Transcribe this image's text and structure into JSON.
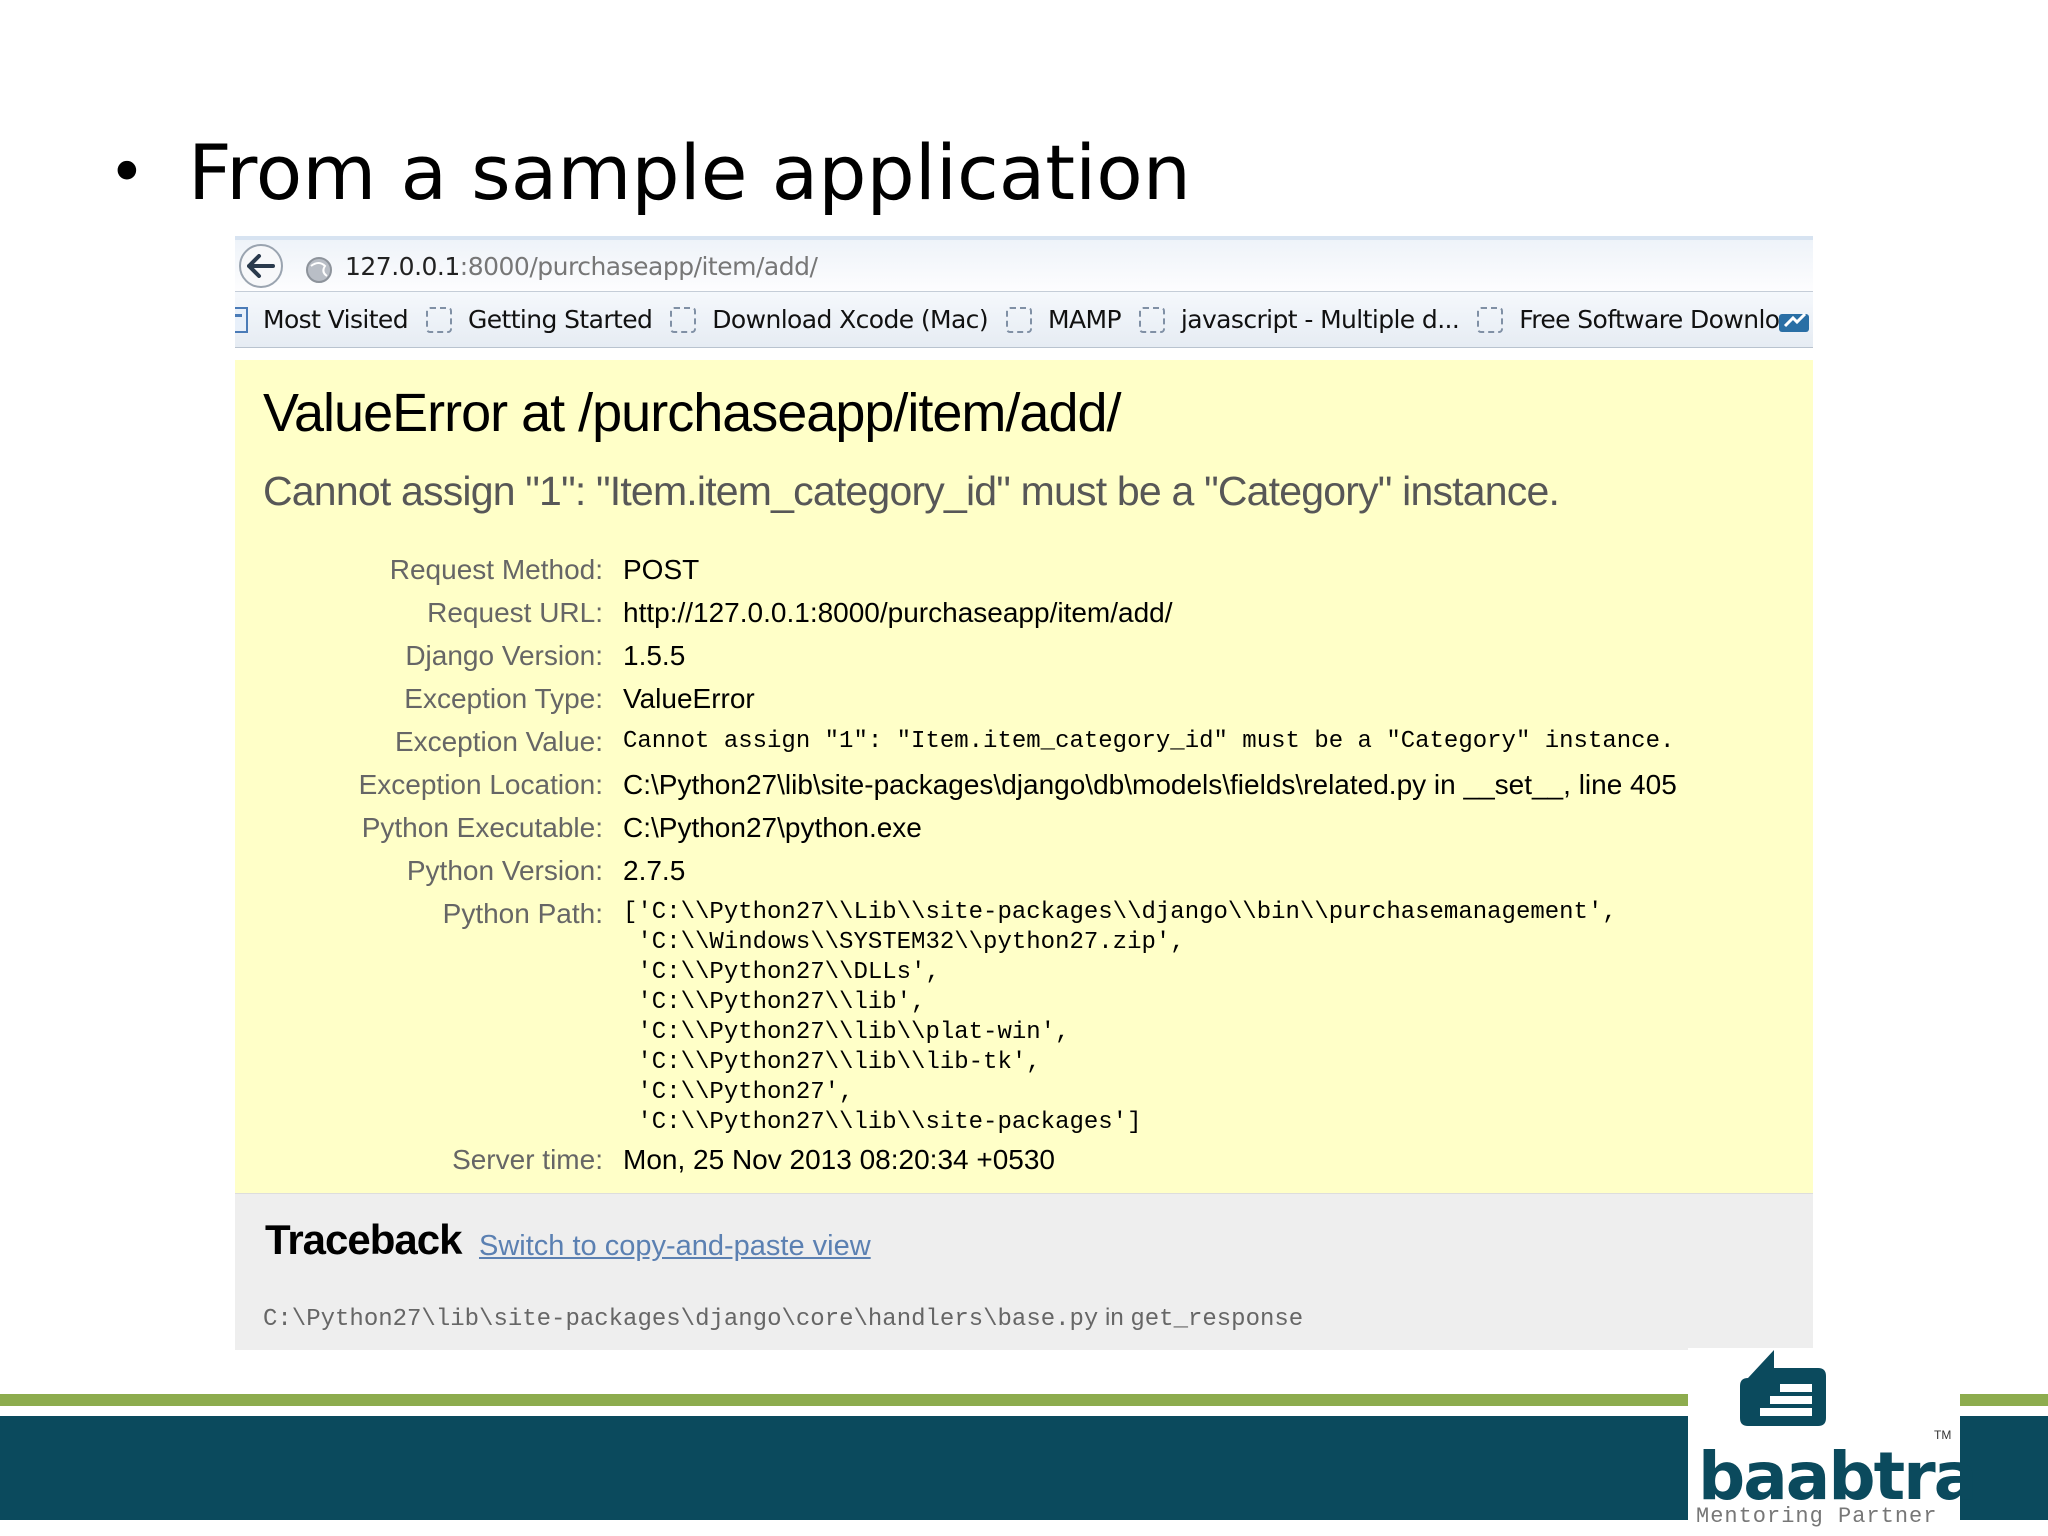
{
  "slide": {
    "bullet": "•",
    "title": "From a sample application"
  },
  "browser": {
    "url_host": "127.0.0.1",
    "url_rest": ":8000/purchaseapp/item/add/",
    "bookmarks": [
      {
        "label": "Most Visited",
        "icon": "page-icon"
      },
      {
        "label": "Getting Started",
        "icon": "bookmark-folder-icon"
      },
      {
        "label": "Download Xcode (Mac)",
        "icon": "bookmark-folder-icon"
      },
      {
        "label": "MAMP",
        "icon": "bookmark-folder-icon"
      },
      {
        "label": "javascript - Multiple d...",
        "icon": "bookmark-folder-icon"
      },
      {
        "label": "Free Software Downlo...",
        "icon": "bookmark-folder-icon"
      }
    ]
  },
  "error": {
    "title": "ValueError at /purchaseapp/item/add/",
    "subtitle": "Cannot assign \"1\": \"Item.item_category_id\" must be a \"Category\" instance.",
    "meta": {
      "request_method_label": "Request Method:",
      "request_method": "POST",
      "request_url_label": "Request URL:",
      "request_url": "http://127.0.0.1:8000/purchaseapp/item/add/",
      "django_version_label": "Django Version:",
      "django_version": "1.5.5",
      "exception_type_label": "Exception Type:",
      "exception_type": "ValueError",
      "exception_value_label": "Exception Value:",
      "exception_value": "Cannot assign \"1\": \"Item.item_category_id\" must be a \"Category\" instance.",
      "exception_location_label": "Exception Location:",
      "exception_location": "C:\\Python27\\lib\\site-packages\\django\\db\\models\\fields\\related.py in __set__, line 405",
      "python_executable_label": "Python Executable:",
      "python_executable": "C:\\Python27\\python.exe",
      "python_version_label": "Python Version:",
      "python_version": "2.7.5",
      "python_path_label": "Python Path:",
      "python_path": "['C:\\\\Python27\\\\Lib\\\\site-packages\\\\django\\\\bin\\\\purchasemanagement',\n 'C:\\\\Windows\\\\SYSTEM32\\\\python27.zip',\n 'C:\\\\Python27\\\\DLLs',\n 'C:\\\\Python27\\\\lib',\n 'C:\\\\Python27\\\\lib\\\\plat-win',\n 'C:\\\\Python27\\\\lib\\\\lib-tk',\n 'C:\\\\Python27',\n 'C:\\\\Python27\\\\lib\\\\site-packages']",
      "server_time_label": "Server time:",
      "server_time": "Mon, 25 Nov 2013 08:20:34 +0530"
    }
  },
  "traceback": {
    "title": "Traceback",
    "switch_link": "Switch to copy-and-paste view",
    "frame_file": "C:\\Python27\\lib\\site-packages\\django\\core\\handlers\\base.py",
    "frame_in": " in ",
    "frame_function": "get_response"
  },
  "logo": {
    "name": "baabtra",
    "tagline": "Mentoring Partner",
    "tm": "TM"
  },
  "colors": {
    "summary_bg": "#ffffc8",
    "traceback_bg": "#eeeeee",
    "link": "#5b80b2",
    "footer_band": "#0b4a5d",
    "footer_green": "#8dac4e"
  }
}
